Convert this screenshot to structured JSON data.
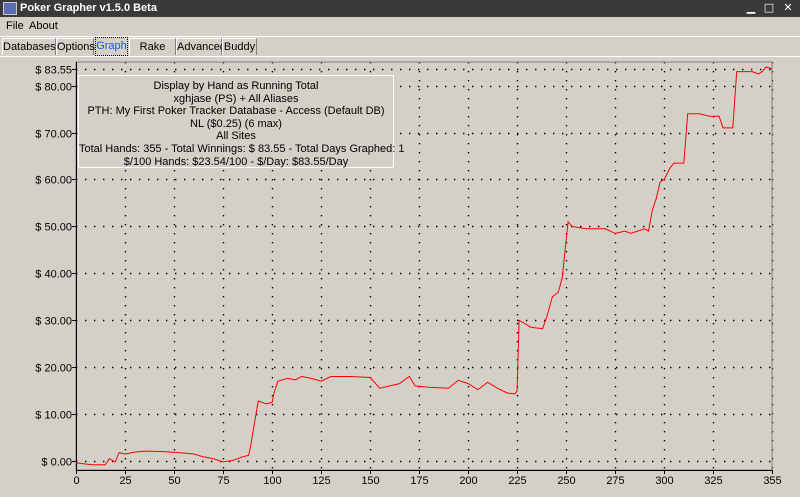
{
  "window": {
    "title": "Poker Grapher v1.5.0 Beta",
    "minimize_glyph": "▁",
    "restore_glyph": "□",
    "close_glyph": "✕"
  },
  "menu": {
    "items": [
      "File",
      "About"
    ]
  },
  "tabs": {
    "items": [
      "Databases",
      "Options",
      "Graph",
      "Rake Calc",
      "Advanced",
      "Buddy"
    ],
    "active": "Graph"
  },
  "info_box": {
    "lines": [
      "Display by Hand as Running Total",
      "xghjase (PS) + All Aliases",
      "PTH: My First Poker Tracker Database - Access (Default DB)",
      "NL ($0.25) (6 max)",
      "All Sites",
      "Total Hands: 355 - Total Winnings: $ 83.55 - Total Days Graphed: 1",
      "$/100 Hands: $23.54/100 - $/Day: $83.55/Day"
    ]
  },
  "colors": {
    "line": "#ff0000",
    "grid": "#000000",
    "background": "#d4d0c8"
  },
  "chart_data": {
    "type": "line",
    "x_ticks": [
      0,
      25,
      50,
      75,
      100,
      125,
      150,
      175,
      200,
      225,
      250,
      275,
      300,
      325,
      355
    ],
    "y_tick_values": [
      0,
      10,
      20,
      30,
      40,
      50,
      60,
      70,
      80,
      83.55
    ],
    "y_tick_labels": [
      "$ 0.00",
      "$ 10.00",
      "$ 20.00",
      "$ 30.00",
      "$ 40.00",
      "$ 50.00",
      "$ 60.00",
      "$ 70.00",
      "$ 80.00",
      "$ 83.55"
    ],
    "xlim": [
      0,
      355
    ],
    "ylim": [
      -1.5,
      84
    ],
    "grid": true,
    "series": [
      {
        "values": [
          [
            0,
            -0.4
          ],
          [
            8,
            -0.8
          ],
          [
            15,
            -0.8
          ],
          [
            17,
            0.5
          ],
          [
            20,
            -0.2
          ],
          [
            22,
            1.8
          ],
          [
            25,
            1.5
          ],
          [
            30,
            1.9
          ],
          [
            35,
            2.1
          ],
          [
            45,
            2.0
          ],
          [
            55,
            1.7
          ],
          [
            60,
            1.5
          ],
          [
            65,
            0.9
          ],
          [
            70,
            0.5
          ],
          [
            75,
            -0.2
          ],
          [
            80,
            0.1
          ],
          [
            85,
            0.9
          ],
          [
            88,
            1.2
          ],
          [
            89,
            3
          ],
          [
            91,
            8
          ],
          [
            93,
            12.8
          ],
          [
            97,
            12.2
          ],
          [
            100,
            12.5
          ],
          [
            101,
            14.5
          ],
          [
            103,
            17
          ],
          [
            108,
            17.6
          ],
          [
            112,
            17.3
          ],
          [
            115,
            18
          ],
          [
            120,
            17.6
          ],
          [
            125,
            17
          ],
          [
            130,
            18
          ],
          [
            140,
            18
          ],
          [
            150,
            17.8
          ],
          [
            155,
            15.5
          ],
          [
            160,
            16
          ],
          [
            165,
            16.5
          ],
          [
            170,
            18
          ],
          [
            173,
            16
          ],
          [
            180,
            15.7
          ],
          [
            190,
            15.5
          ],
          [
            195,
            17.2
          ],
          [
            200,
            16.5
          ],
          [
            205,
            15.2
          ],
          [
            210,
            16.8
          ],
          [
            215,
            15.5
          ],
          [
            220,
            14.5
          ],
          [
            224,
            14.3
          ],
          [
            225,
            15
          ],
          [
            226,
            30
          ],
          [
            232,
            28.5
          ],
          [
            238,
            28.2
          ],
          [
            240,
            30.5
          ],
          [
            243,
            35
          ],
          [
            246,
            36
          ],
          [
            248,
            39
          ],
          [
            250,
            47
          ],
          [
            251,
            51
          ],
          [
            253,
            50
          ],
          [
            260,
            49.5
          ],
          [
            270,
            49.5
          ],
          [
            275,
            48.5
          ],
          [
            280,
            49
          ],
          [
            283,
            48.5
          ],
          [
            290,
            49.5
          ],
          [
            292,
            49
          ],
          [
            294,
            53.5
          ],
          [
            296,
            56
          ],
          [
            298,
            59.5
          ],
          [
            300,
            60
          ],
          [
            303,
            62.5
          ],
          [
            305,
            63.5
          ],
          [
            310,
            63.5
          ],
          [
            312,
            74
          ],
          [
            318,
            74
          ],
          [
            323,
            73.5
          ],
          [
            328,
            73.5
          ],
          [
            330,
            71
          ],
          [
            335,
            71
          ],
          [
            337,
            83
          ],
          [
            345,
            83
          ],
          [
            348,
            82.5
          ],
          [
            350,
            83
          ],
          [
            352,
            84
          ],
          [
            355,
            83.55
          ]
        ],
        "color": "#ff0000"
      }
    ]
  }
}
